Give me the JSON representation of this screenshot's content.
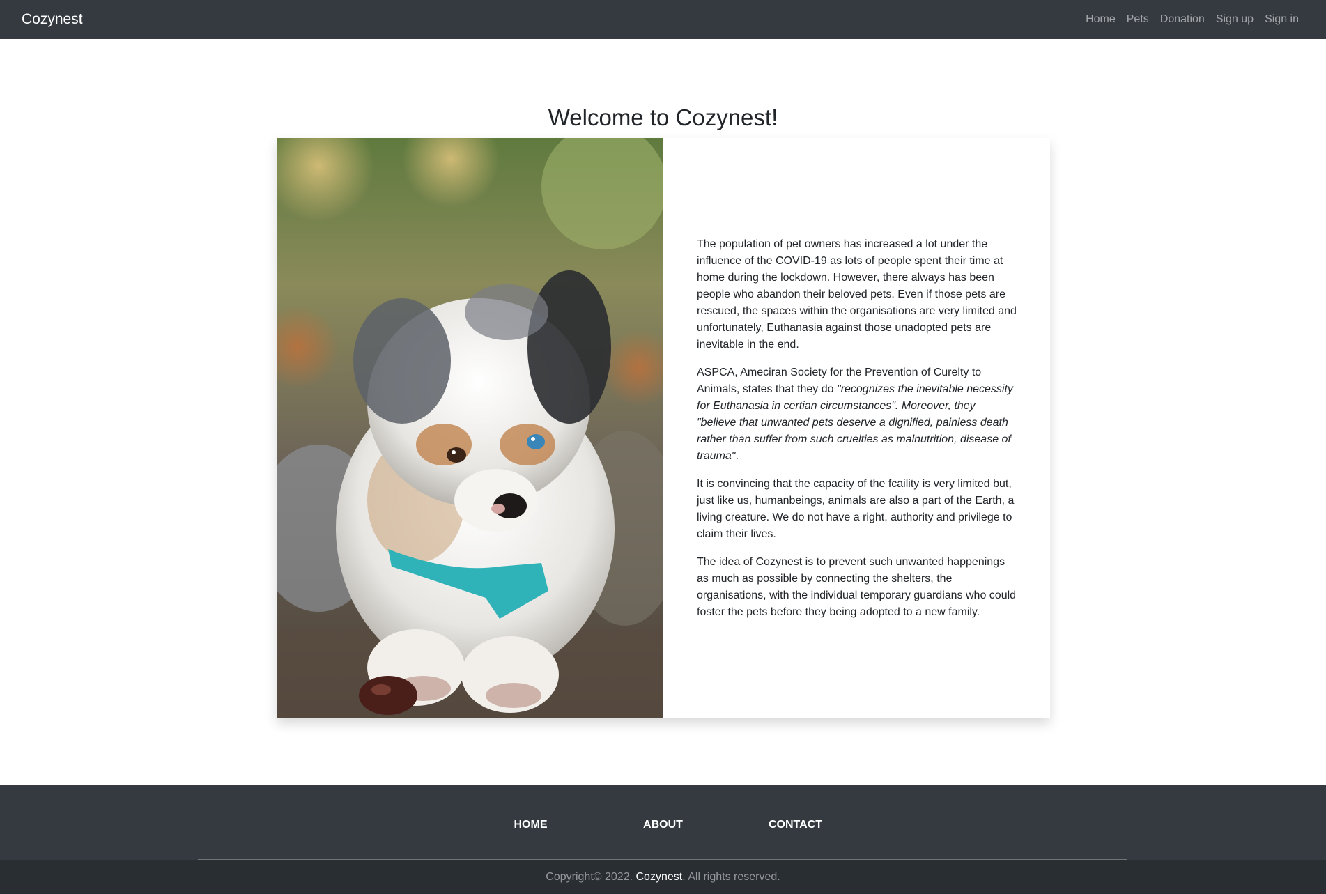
{
  "navbar": {
    "brand": "Cozynest",
    "links": [
      "Home",
      "Pets",
      "Donation",
      "Sign up",
      "Sign in"
    ]
  },
  "main": {
    "heading": "Welcome to Cozynest!",
    "image_alt": "puppy-photo",
    "paragraphs": {
      "p1": "The population of pet owners has increased a lot under the influence of the COVID-19 as lots of people spent their time at home during the lockdown. However, there always has been people who abandon their beloved pets. Even if those pets are rescued, the spaces within the organisations are very limited and unfortunately, Euthanasia against those unadopted pets are inevitable in the end.",
      "p2_lead": "ASPCA, Ameciran Society for the Prevention of Curelty to Animals, states that they do ",
      "p2_quote": "\"recognizes the inevitable necessity for Euthanasia in certian circumstances\". Moreover, they \"believe that unwanted pets deserve a dignified, painless death rather than suffer from such cruelties as malnutrition, disease of trauma\"",
      "p2_end": ".",
      "p3": "It is convincing that the capacity of the fcaility is very limited but, just like us, humanbeings, animals are also a part of the Earth, a living creature. We do not have a right, authority and privilege to claim their lives.",
      "p4": "The idea of Cozynest is to prevent such unwanted happenings as much as possible by connecting the shelters, the organisations, with the individual temporary guardians who could foster the pets before they being adopted to a new family."
    }
  },
  "footer": {
    "links": [
      "HOME",
      "ABOUT",
      "CONTACT"
    ],
    "copyright_prefix": "Copyright© 2022. ",
    "copyright_brand": "Cozynest",
    "copyright_suffix": ". All rights reserved."
  }
}
